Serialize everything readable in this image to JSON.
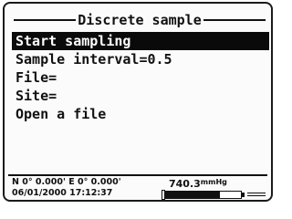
{
  "screen": {
    "title": "Discrete sample"
  },
  "menu": {
    "items": [
      {
        "label": "Start sampling",
        "selected": true
      },
      {
        "label": "Sample interval=0.5",
        "selected": false
      },
      {
        "label": "File=",
        "selected": false
      },
      {
        "label": "Site=",
        "selected": false
      },
      {
        "label": "Open a file",
        "selected": false
      }
    ]
  },
  "status": {
    "gps": "N 0° 0.000' E 0° 0.000'",
    "datetime": "06/01/2000 17:12:37",
    "barometer_value": "740.3",
    "barometer_unit": "mmHg",
    "battery_level": 0.72,
    "battery_icon": "battery-icon"
  },
  "colors": {
    "selection_background": "#0a0a0a",
    "text": "#111111",
    "screen_background": "#fbfbfb"
  }
}
